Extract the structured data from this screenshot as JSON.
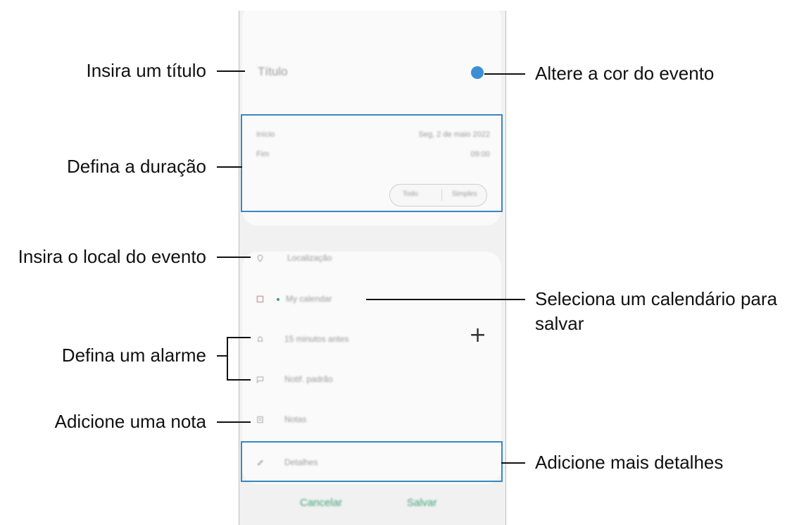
{
  "form": {
    "title_placeholder": "Título",
    "start_label": "Início",
    "start_value": "Seg, 2 de maio 2022",
    "end_label": "Fim",
    "end_value": "09:00",
    "toggle_left": "Todo",
    "toggle_right": "Simples",
    "location_placeholder": "Localização",
    "calendar_value": "My calendar",
    "alarm_value": "15 minutos antes",
    "reminder_value": "Notif. padrão",
    "note_placeholder": "Notas",
    "more_details": "Detalhes",
    "event_color": "#3d8fd5",
    "buttons": {
      "cancel": "Cancelar",
      "save": "Salvar"
    }
  },
  "annotations": {
    "title": "Insira um título",
    "color": "Altere a cor do evento",
    "duration": "Defina a duração",
    "location": "Insira o local do evento",
    "calendar_line1": "Seleciona um calendário para",
    "calendar_line2": "salvar",
    "alarm": "Defina um alarme",
    "note": "Adicione uma nota",
    "details": "Adicione mais detalhes"
  }
}
